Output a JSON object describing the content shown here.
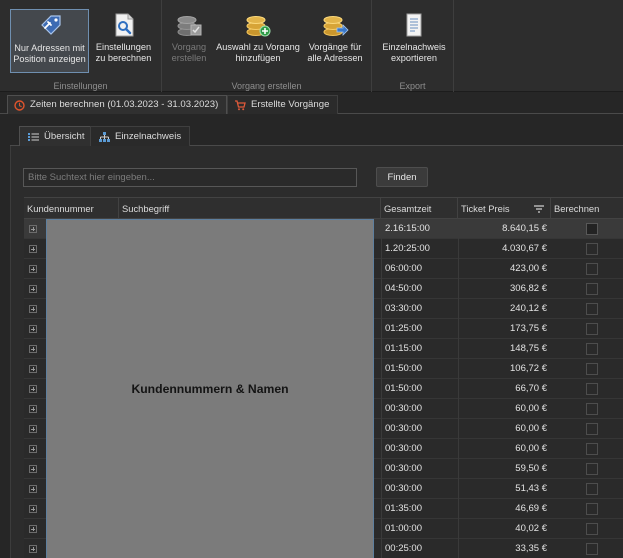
{
  "ribbon": {
    "groups": [
      {
        "label": "Einstellungen"
      },
      {
        "label": "Vorgang erstellen"
      },
      {
        "label": "Export"
      }
    ],
    "buttons": [
      {
        "label": "Nur Adressen mit\nPosition anzeigen",
        "icon": "tag-wrench-icon"
      },
      {
        "label": "Einstellungen\nzu berechnen",
        "icon": "document-search-icon"
      },
      {
        "label": "Vorgang\nerstellen",
        "icon": "coins-check-icon"
      },
      {
        "label": "Auswahl zu Vorgang\nhinzufügen",
        "icon": "coins-add-icon"
      },
      {
        "label": "Vorgänge für\nalle Adressen",
        "icon": "coins-arrow-icon"
      },
      {
        "label": "Einzelnachweis\nexportieren",
        "icon": "document-export-icon"
      }
    ]
  },
  "doc_tabs": [
    {
      "label": "Zeiten berechnen (01.03.2023 - 31.03.2023)",
      "icon": "clock-icon"
    },
    {
      "label": "Erstellte Vorgänge",
      "icon": "cart-icon"
    }
  ],
  "inner_tabs": [
    {
      "label": "Übersicht",
      "icon": "list-icon"
    },
    {
      "label": "Einzelnachweis",
      "icon": "hierarchy-icon"
    }
  ],
  "search": {
    "placeholder": "Bitte Suchtext hier eingeben...",
    "value": "",
    "button": "Finden"
  },
  "grid": {
    "columns": [
      "Kundennummer",
      "Suchbegriff",
      "Gesamtzeit",
      "Ticket Preis",
      "Berechnen"
    ],
    "rows": [
      {
        "time": "2.16:15:00",
        "price": "8.640,15 €"
      },
      {
        "time": "1.20:25:00",
        "price": "4.030,67 €"
      },
      {
        "time": "06:00:00",
        "price": "423,00 €"
      },
      {
        "time": "04:50:00",
        "price": "306,82 €"
      },
      {
        "time": "03:30:00",
        "price": "240,12 €"
      },
      {
        "time": "01:25:00",
        "price": "173,75 €"
      },
      {
        "time": "01:15:00",
        "price": "148,75 €"
      },
      {
        "time": "01:50:00",
        "price": "106,72 €"
      },
      {
        "time": "01:50:00",
        "price": "66,70 €"
      },
      {
        "time": "00:30:00",
        "price": "60,00 €"
      },
      {
        "time": "00:30:00",
        "price": "60,00 €"
      },
      {
        "time": "00:30:00",
        "price": "60,00 €"
      },
      {
        "time": "00:30:00",
        "price": "59,50 €"
      },
      {
        "time": "00:30:00",
        "price": "51,43 €"
      },
      {
        "time": "01:35:00",
        "price": "46,69 €"
      },
      {
        "time": "01:00:00",
        "price": "40,02 €"
      },
      {
        "time": "00:25:00",
        "price": "33,35 €"
      }
    ],
    "overlay_text": "Kundennummern & Namen"
  }
}
